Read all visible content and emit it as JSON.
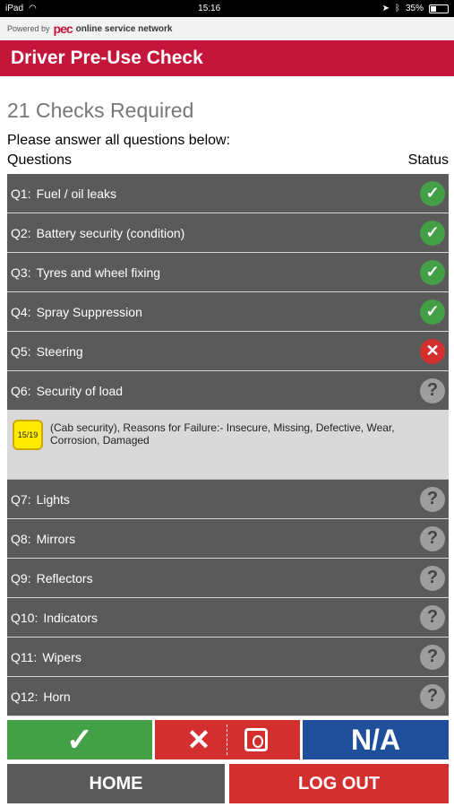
{
  "status_bar": {
    "device": "iPad",
    "time": "15:16",
    "battery": "35%",
    "battery_level": 0.35
  },
  "powered_by": {
    "prefix": "Powered by",
    "logo": "pec",
    "tagline": "online service network"
  },
  "banner": {
    "title": "Driver Pre-Use Check"
  },
  "heading": "21 Checks Required",
  "instruction": "Please answer all questions below:",
  "columns": {
    "questions": "Questions",
    "status": "Status"
  },
  "questions": [
    {
      "number": "Q1:",
      "label": "Fuel / oil leaks",
      "status": "pass",
      "icon": "check-icon",
      "glyph": "✓"
    },
    {
      "number": "Q2:",
      "label": "Battery security (condition)",
      "status": "pass",
      "icon": "check-icon",
      "glyph": "✓"
    },
    {
      "number": "Q3:",
      "label": "Tyres and wheel fixing",
      "status": "pass",
      "icon": "check-icon",
      "glyph": "✓"
    },
    {
      "number": "Q4:",
      "label": "Spray Suppression",
      "status": "pass",
      "icon": "check-icon",
      "glyph": "✓"
    },
    {
      "number": "Q5:",
      "label": "Steering",
      "status": "fail",
      "icon": "cross-icon",
      "glyph": "✕"
    },
    {
      "number": "Q6:",
      "label": "Security of load",
      "status": "unknown",
      "icon": "question-icon",
      "glyph": "?"
    },
    {
      "number": "Q7:",
      "label": "Lights",
      "status": "unknown",
      "icon": "question-icon",
      "glyph": "?"
    },
    {
      "number": "Q8:",
      "label": "Mirrors",
      "status": "unknown",
      "icon": "question-icon",
      "glyph": "?"
    },
    {
      "number": "Q9:",
      "label": "Reflectors",
      "status": "unknown",
      "icon": "question-icon",
      "glyph": "?"
    },
    {
      "number": "Q10:",
      "label": "Indicators",
      "status": "unknown",
      "icon": "question-icon",
      "glyph": "?"
    },
    {
      "number": "Q11:",
      "label": "Wipers",
      "status": "unknown",
      "icon": "question-icon",
      "glyph": "?"
    },
    {
      "number": "Q12:",
      "label": "Horn",
      "status": "unknown",
      "icon": "question-icon",
      "glyph": "?"
    }
  ],
  "fail_detail": {
    "badge": "15/19",
    "text": "(Cab security), Reasons for Failure:- Insecure, Missing, Defective, Wear, Corrosion, Damaged"
  },
  "actions": {
    "yes_label": "✓",
    "no_label": "✕",
    "na_label": "N/A"
  },
  "nav": {
    "home_label": "HOME",
    "logout_label": "LOG OUT"
  },
  "colors": {
    "brand_red": "#c4163a",
    "pass_green": "#43a047",
    "fail_red": "#d32f2f",
    "na_blue": "#1f4e9a",
    "row_gray": "#5a5a5a"
  }
}
